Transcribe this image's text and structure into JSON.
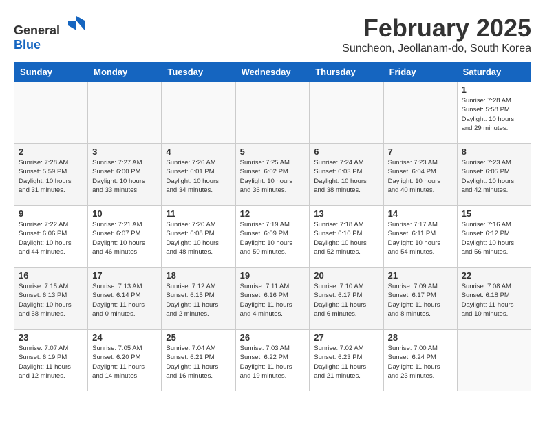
{
  "header": {
    "logo_general": "General",
    "logo_blue": "Blue",
    "month": "February 2025",
    "location": "Suncheon, Jeollanam-do, South Korea"
  },
  "weekdays": [
    "Sunday",
    "Monday",
    "Tuesday",
    "Wednesday",
    "Thursday",
    "Friday",
    "Saturday"
  ],
  "weeks": [
    [
      {
        "day": "",
        "info": ""
      },
      {
        "day": "",
        "info": ""
      },
      {
        "day": "",
        "info": ""
      },
      {
        "day": "",
        "info": ""
      },
      {
        "day": "",
        "info": ""
      },
      {
        "day": "",
        "info": ""
      },
      {
        "day": "1",
        "info": "Sunrise: 7:28 AM\nSunset: 5:58 PM\nDaylight: 10 hours\nand 29 minutes."
      }
    ],
    [
      {
        "day": "2",
        "info": "Sunrise: 7:28 AM\nSunset: 5:59 PM\nDaylight: 10 hours\nand 31 minutes."
      },
      {
        "day": "3",
        "info": "Sunrise: 7:27 AM\nSunset: 6:00 PM\nDaylight: 10 hours\nand 33 minutes."
      },
      {
        "day": "4",
        "info": "Sunrise: 7:26 AM\nSunset: 6:01 PM\nDaylight: 10 hours\nand 34 minutes."
      },
      {
        "day": "5",
        "info": "Sunrise: 7:25 AM\nSunset: 6:02 PM\nDaylight: 10 hours\nand 36 minutes."
      },
      {
        "day": "6",
        "info": "Sunrise: 7:24 AM\nSunset: 6:03 PM\nDaylight: 10 hours\nand 38 minutes."
      },
      {
        "day": "7",
        "info": "Sunrise: 7:23 AM\nSunset: 6:04 PM\nDaylight: 10 hours\nand 40 minutes."
      },
      {
        "day": "8",
        "info": "Sunrise: 7:23 AM\nSunset: 6:05 PM\nDaylight: 10 hours\nand 42 minutes."
      }
    ],
    [
      {
        "day": "9",
        "info": "Sunrise: 7:22 AM\nSunset: 6:06 PM\nDaylight: 10 hours\nand 44 minutes."
      },
      {
        "day": "10",
        "info": "Sunrise: 7:21 AM\nSunset: 6:07 PM\nDaylight: 10 hours\nand 46 minutes."
      },
      {
        "day": "11",
        "info": "Sunrise: 7:20 AM\nSunset: 6:08 PM\nDaylight: 10 hours\nand 48 minutes."
      },
      {
        "day": "12",
        "info": "Sunrise: 7:19 AM\nSunset: 6:09 PM\nDaylight: 10 hours\nand 50 minutes."
      },
      {
        "day": "13",
        "info": "Sunrise: 7:18 AM\nSunset: 6:10 PM\nDaylight: 10 hours\nand 52 minutes."
      },
      {
        "day": "14",
        "info": "Sunrise: 7:17 AM\nSunset: 6:11 PM\nDaylight: 10 hours\nand 54 minutes."
      },
      {
        "day": "15",
        "info": "Sunrise: 7:16 AM\nSunset: 6:12 PM\nDaylight: 10 hours\nand 56 minutes."
      }
    ],
    [
      {
        "day": "16",
        "info": "Sunrise: 7:15 AM\nSunset: 6:13 PM\nDaylight: 10 hours\nand 58 minutes."
      },
      {
        "day": "17",
        "info": "Sunrise: 7:13 AM\nSunset: 6:14 PM\nDaylight: 11 hours\nand 0 minutes."
      },
      {
        "day": "18",
        "info": "Sunrise: 7:12 AM\nSunset: 6:15 PM\nDaylight: 11 hours\nand 2 minutes."
      },
      {
        "day": "19",
        "info": "Sunrise: 7:11 AM\nSunset: 6:16 PM\nDaylight: 11 hours\nand 4 minutes."
      },
      {
        "day": "20",
        "info": "Sunrise: 7:10 AM\nSunset: 6:17 PM\nDaylight: 11 hours\nand 6 minutes."
      },
      {
        "day": "21",
        "info": "Sunrise: 7:09 AM\nSunset: 6:17 PM\nDaylight: 11 hours\nand 8 minutes."
      },
      {
        "day": "22",
        "info": "Sunrise: 7:08 AM\nSunset: 6:18 PM\nDaylight: 11 hours\nand 10 minutes."
      }
    ],
    [
      {
        "day": "23",
        "info": "Sunrise: 7:07 AM\nSunset: 6:19 PM\nDaylight: 11 hours\nand 12 minutes."
      },
      {
        "day": "24",
        "info": "Sunrise: 7:05 AM\nSunset: 6:20 PM\nDaylight: 11 hours\nand 14 minutes."
      },
      {
        "day": "25",
        "info": "Sunrise: 7:04 AM\nSunset: 6:21 PM\nDaylight: 11 hours\nand 16 minutes."
      },
      {
        "day": "26",
        "info": "Sunrise: 7:03 AM\nSunset: 6:22 PM\nDaylight: 11 hours\nand 19 minutes."
      },
      {
        "day": "27",
        "info": "Sunrise: 7:02 AM\nSunset: 6:23 PM\nDaylight: 11 hours\nand 21 minutes."
      },
      {
        "day": "28",
        "info": "Sunrise: 7:00 AM\nSunset: 6:24 PM\nDaylight: 11 hours\nand 23 minutes."
      },
      {
        "day": "",
        "info": ""
      }
    ]
  ]
}
